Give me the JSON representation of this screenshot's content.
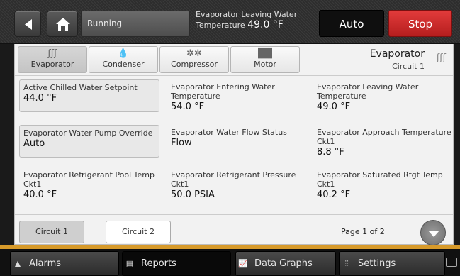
{
  "topbar": {
    "status": "Running",
    "leaving_label_1": "Evaporator Leaving Water",
    "leaving_label_2": "Temperature",
    "leaving_value": "49.0 °F",
    "auto_label": "Auto",
    "stop_label": "Stop",
    "colors": {
      "stop": "#d02a2a"
    }
  },
  "tabs": [
    {
      "label": "Evaporator",
      "icon": "heat-wave-icon",
      "glyph": "ʃʃʃ"
    },
    {
      "label": "Condenser",
      "icon": "droplets-icon",
      "glyph": "💧"
    },
    {
      "label": "Compressor",
      "icon": "compressor-icon",
      "glyph": "✲✲"
    },
    {
      "label": "Motor",
      "icon": "motor-icon",
      "glyph": "▐█▌"
    }
  ],
  "section": {
    "title": "Evaporator",
    "subtitle": "Circuit 1"
  },
  "fields": [
    {
      "label": "Active Chilled Water Setpoint",
      "value": "44.0 °F"
    },
    {
      "label": "Evaporator Entering Water Temperature",
      "value": "54.0 °F"
    },
    {
      "label": "Evaporator Leaving Water Temperature",
      "value": "49.0 °F"
    },
    {
      "label": "Evaporator Water Pump Override",
      "value": "Auto"
    },
    {
      "label": "Evaporator Water Flow Status",
      "value": "Flow"
    },
    {
      "label": "Evaporator Approach Temperature Ckt1",
      "value": "8.8 °F"
    },
    {
      "label": "Evaporator Refrigerant Pool Temp Ckt1",
      "value": "40.0 °F"
    },
    {
      "label": "Evaporator Refrigerant Pressure Ckt1",
      "value": "50.0 PSIA"
    },
    {
      "label": "Evaporator Saturated Rfgt Temp Ckt1",
      "value": "40.2 °F"
    }
  ],
  "circuits": [
    "Circuit 1",
    "Circuit 2"
  ],
  "page": "Page 1 of 2",
  "nav": [
    {
      "label": "Alarms",
      "glyph": "▲"
    },
    {
      "label": "Reports",
      "glyph": "▤"
    },
    {
      "label": "Data Graphs",
      "glyph": "📈"
    },
    {
      "label": "Settings",
      "glyph": "⫶⫶"
    }
  ]
}
